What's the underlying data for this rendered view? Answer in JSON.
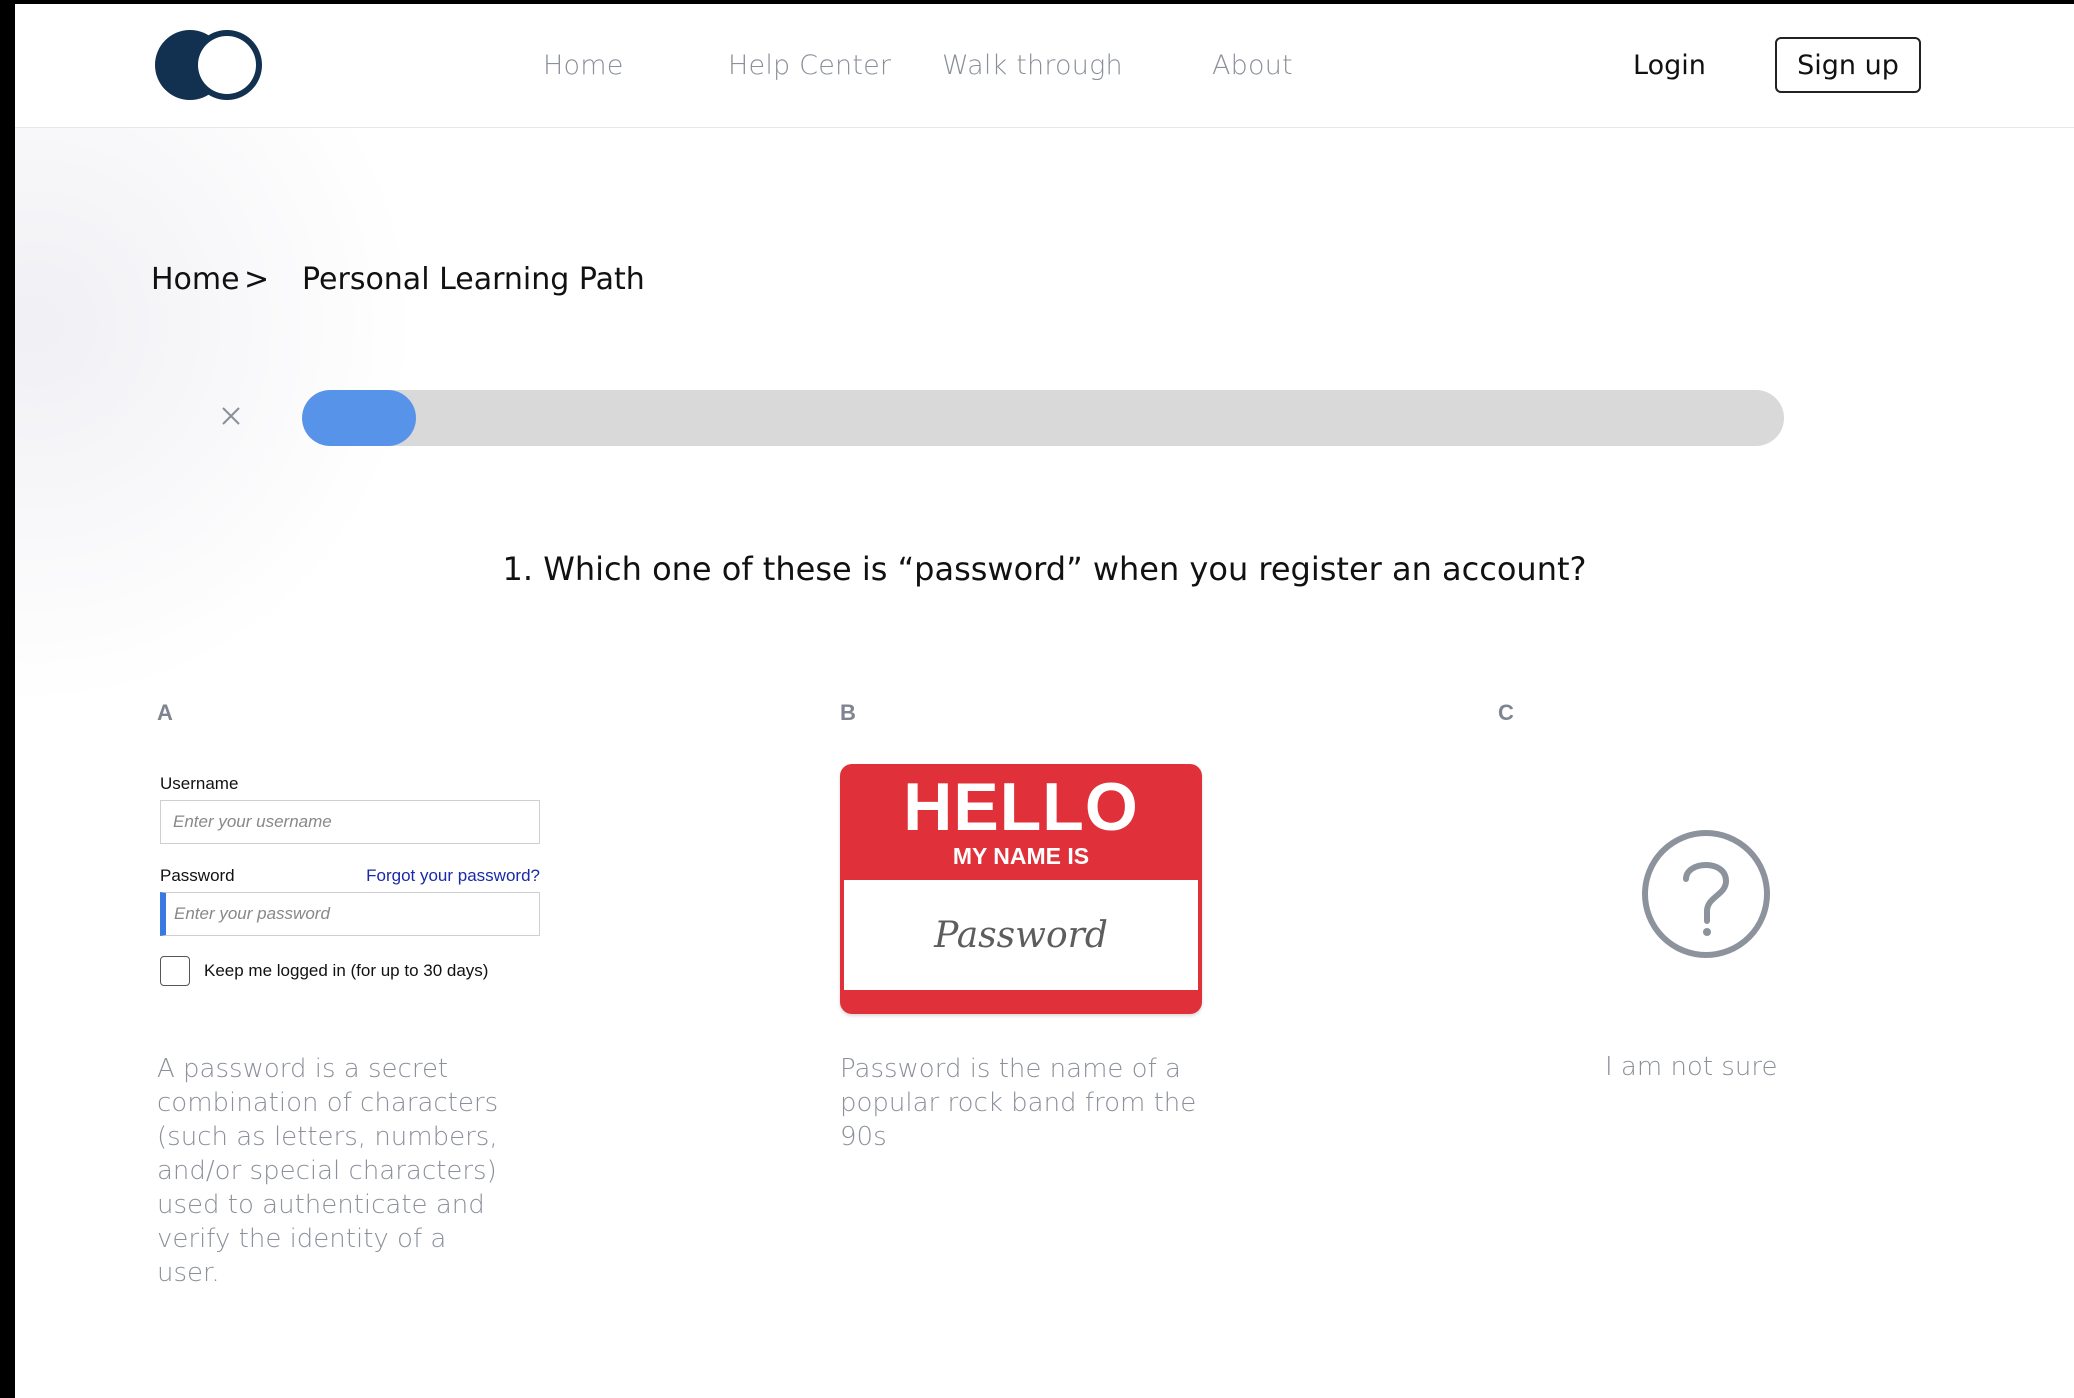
{
  "nav": {
    "links": [
      "Home",
      "Help Center",
      "Walk through",
      "About"
    ],
    "login": "Login",
    "signup": "Sign up"
  },
  "breadcrumb": {
    "home": "Home",
    "separator": ">",
    "current": "Personal Learning Path"
  },
  "progress": {
    "fraction": 0.077
  },
  "question": "1. Which one of these is “password” when you register an account?",
  "options": {
    "a": {
      "letter": "A",
      "login_mock": {
        "username_label": "Username",
        "username_placeholder": "Enter your username",
        "password_label": "Password",
        "forgot": "Forgot your password?",
        "password_placeholder": "Enter your password",
        "keep": "Keep me logged in (for up to 30 days)"
      },
      "description": "A password is a secret combination of characters (such as letters, numbers, and/or special characters) used to authenticate and verify the identity of a user."
    },
    "b": {
      "letter": "B",
      "tag": {
        "hello": "HELLO",
        "my_name_is": "MY NAME IS",
        "name": "Password"
      },
      "description": "Password is the name of a popular rock band from the 90s"
    },
    "c": {
      "letter": "C",
      "description": "I am not sure"
    }
  },
  "colors": {
    "progress_fill": "#5893ea",
    "progress_track": "#d9d9d9",
    "logo": "#12304f",
    "tag_red": "#e0303a",
    "muted_text": "#8b909a"
  }
}
